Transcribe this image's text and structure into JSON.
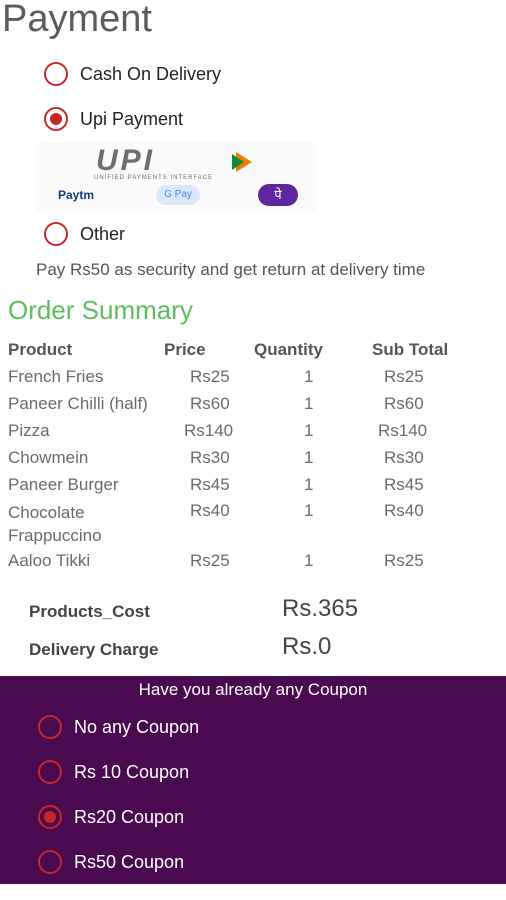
{
  "payment": {
    "title": "Payment",
    "options": [
      {
        "label": "Cash On Delivery",
        "selected": false
      },
      {
        "label": "Upi Payment",
        "selected": true
      },
      {
        "label": "Other",
        "selected": false
      }
    ],
    "upi_logo": {
      "brand": "UPI",
      "tagline": "UNIFIED PAYMENTS INTERFACE",
      "apps": [
        "Paytm",
        "G Pay",
        "PhonePe"
      ]
    },
    "security_note": "Pay Rs50 as security and get return at delivery time"
  },
  "order_summary": {
    "title": "Order Summary",
    "columns": [
      "Product",
      "Price",
      "Quantity",
      "Sub Total"
    ],
    "rows": [
      {
        "product": "French Fries",
        "price": "Rs25",
        "qty": "1",
        "subtotal": "Rs25"
      },
      {
        "product": "Paneer Chilli (half)",
        "price": "Rs60",
        "qty": "1",
        "subtotal": "Rs60"
      },
      {
        "product": "Pizza",
        "price": "Rs140",
        "qty": "1",
        "subtotal": "Rs140"
      },
      {
        "product": "Chowmein",
        "price": "Rs30",
        "qty": "1",
        "subtotal": "Rs30"
      },
      {
        "product": "Paneer Burger",
        "price": "Rs45",
        "qty": "1",
        "subtotal": "Rs45"
      },
      {
        "product": "Chocolate Frappuccino",
        "price": "Rs40",
        "qty": "1",
        "subtotal": "Rs40"
      },
      {
        "product": "Aaloo Tikki",
        "price": "Rs25",
        "qty": "1",
        "subtotal": "Rs25"
      }
    ],
    "products_cost_label": "Products_Cost",
    "products_cost_value": "Rs.365",
    "delivery_label": "Delivery Charge",
    "delivery_value": "Rs.0"
  },
  "coupon": {
    "title": "Have you already any Coupon",
    "options": [
      {
        "label": "No any Coupon",
        "selected": false
      },
      {
        "label": "Rs 10 Coupon",
        "selected": false
      },
      {
        "label": "Rs20 Coupon",
        "selected": true
      },
      {
        "label": "Rs50 Coupon",
        "selected": false
      }
    ]
  },
  "colors": {
    "accent_red": "#c62828",
    "summary_green": "#5cbd5c",
    "coupon_bg": "#4a0a4f"
  }
}
